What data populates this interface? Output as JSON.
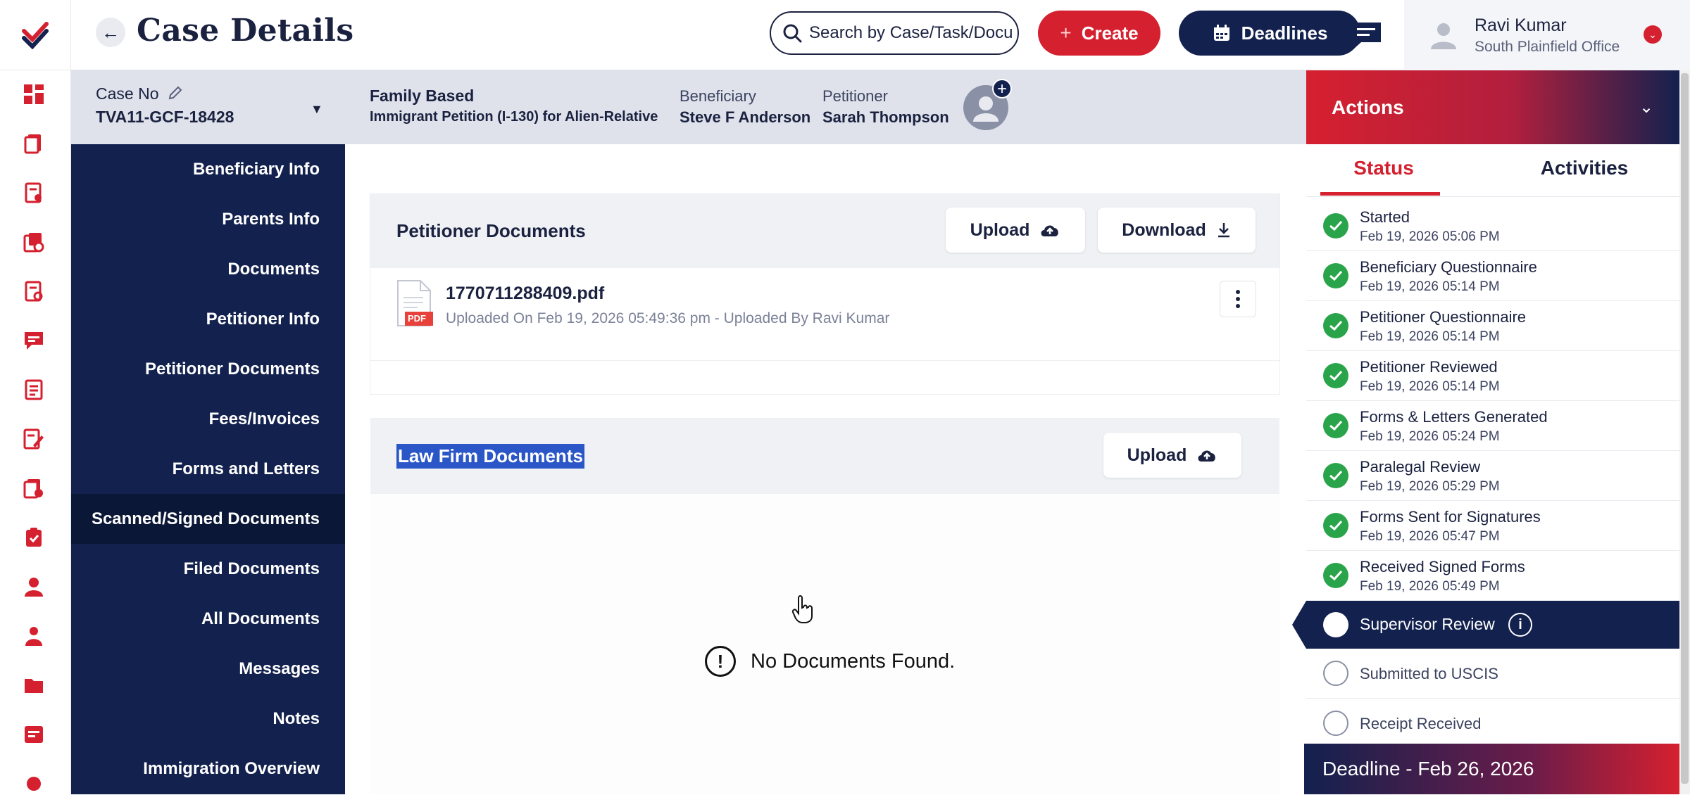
{
  "header": {
    "title": "Case Details",
    "search_placeholder": "Search by Case/Task/Document",
    "search_text": "Search by Case/Task/Docu",
    "create_label": "Create",
    "deadlines_label": "Deadlines",
    "user": {
      "name": "Ravi Kumar",
      "office": "South Plainfield Office"
    }
  },
  "case": {
    "case_no_label": "Case No",
    "case_no": "TVA11-GCF-18428",
    "category": "Family Based",
    "petition_type": "Immigrant Petition (I-130) for Alien-Relative",
    "beneficiary_label": "Beneficiary",
    "beneficiary": "Steve F Anderson",
    "petitioner_label": "Petitioner",
    "petitioner": "Sarah Thompson"
  },
  "nav": {
    "items": [
      {
        "label": "Beneficiary Info"
      },
      {
        "label": "Parents Info"
      },
      {
        "label": "Documents"
      },
      {
        "label": "Petitioner Info"
      },
      {
        "label": "Petitioner Documents"
      },
      {
        "label": "Fees/Invoices"
      },
      {
        "label": "Forms and Letters"
      },
      {
        "label": "Scanned/Signed Documents",
        "active": true
      },
      {
        "label": "Filed Documents"
      },
      {
        "label": "All Documents"
      },
      {
        "label": "Messages"
      },
      {
        "label": "Notes"
      },
      {
        "label": "Immigration Overview"
      }
    ]
  },
  "petitioner_docs": {
    "title": "Petitioner Documents",
    "upload_label": "Upload",
    "download_label": "Download",
    "file": {
      "name": "1770711288409.pdf",
      "meta": "Uploaded On Feb 19, 2026 05:49:36 pm - Uploaded By Ravi Kumar",
      "badge": "PDF"
    }
  },
  "law_firm_docs": {
    "title": "Law Firm Documents",
    "upload_label": "Upload",
    "empty_text": "No Documents Found."
  },
  "actions": {
    "title": "Actions",
    "tabs": {
      "status": "Status",
      "activities": "Activities"
    },
    "statuses": [
      {
        "label": "Started",
        "date": "Feb 19, 2026 05:06 PM"
      },
      {
        "label": "Beneficiary Questionnaire",
        "date": "Feb 19, 2026 05:14 PM"
      },
      {
        "label": "Petitioner Questionnaire",
        "date": "Feb 19, 2026 05:14 PM"
      },
      {
        "label": "Petitioner Reviewed",
        "date": "Feb 19, 2026 05:14 PM"
      },
      {
        "label": "Forms & Letters Generated",
        "date": "Feb 19, 2026 05:24 PM"
      },
      {
        "label": "Paralegal Review",
        "date": "Feb 19, 2026 05:29 PM"
      },
      {
        "label": "Forms Sent for Signatures",
        "date": "Feb 19, 2026 05:47 PM"
      },
      {
        "label": "Received Signed Forms",
        "date": "Feb 19, 2026 05:49 PM"
      }
    ],
    "current": "Supervisor Review",
    "pending": [
      "Submitted to USCIS",
      "Receipt Received"
    ],
    "deadline": "Deadline - Feb 26, 2026"
  },
  "colors": {
    "brand_red": "#d5202f",
    "navy": "#13214e",
    "success": "#2aa44a"
  }
}
